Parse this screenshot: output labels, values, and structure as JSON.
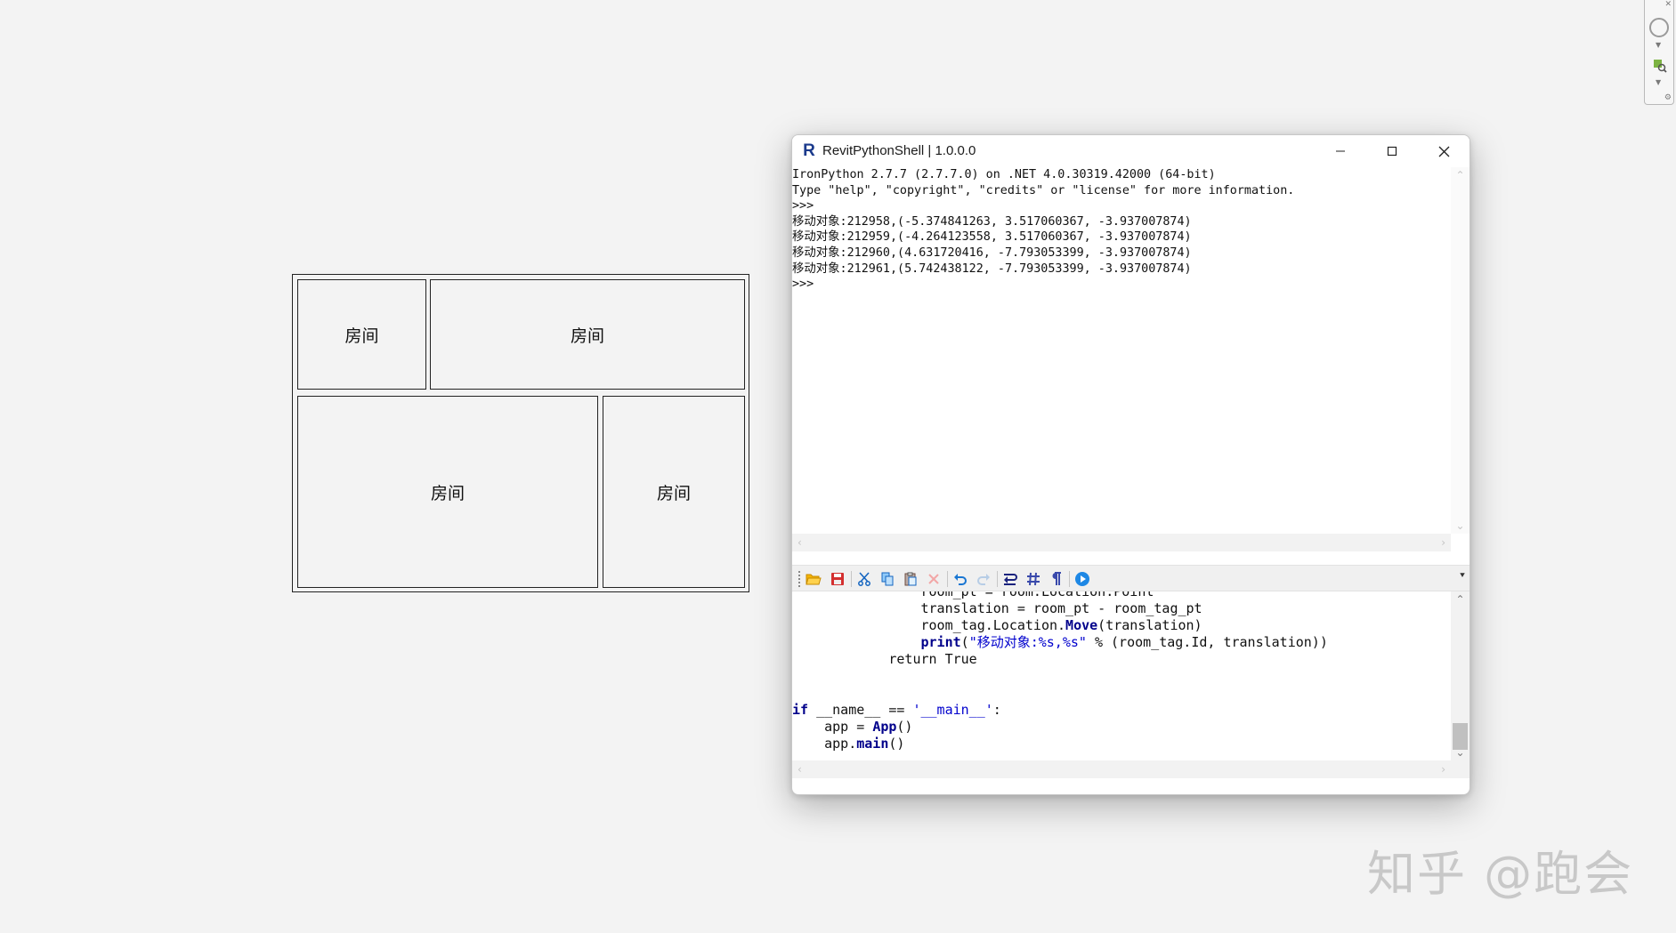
{
  "floor_plan": {
    "rooms": [
      {
        "label": "房间"
      },
      {
        "label": "房间"
      },
      {
        "label": "房间"
      },
      {
        "label": "房间"
      }
    ]
  },
  "navbar": {
    "icons": [
      "close-icon",
      "steering-wheel-icon",
      "dropdown-icon",
      "zoom-icon",
      "dropdown-icon",
      "customize-icon"
    ]
  },
  "shell": {
    "title": "RevitPythonShell | 1.0.0.0",
    "app_icon_letter": "R",
    "output_lines": [
      "IronPython 2.7.7 (2.7.7.0) on .NET 4.0.30319.42000 (64-bit)",
      "Type \"help\", \"copyright\", \"credits\" or \"license\" for more information.",
      ">>>",
      "移动对象:212958,(-5.374841263, 3.517060367, -3.937007874)",
      "移动对象:212959,(-4.264123558, 3.517060367, -3.937007874)",
      "移动对象:212960,(4.631720416, -7.793053399, -3.937007874)",
      "移动对象:212961,(5.742438122, -7.793053399, -3.937007874)",
      ">>>"
    ],
    "toolbar": [
      "open-icon",
      "save-icon",
      "cut-icon",
      "copy-icon",
      "paste-icon",
      "delete-icon",
      "undo-icon",
      "redo-icon",
      "word-wrap-icon",
      "line-numbers-icon",
      "show-whitespace-icon",
      "run-icon"
    ],
    "code": {
      "line0": "                room_pt = room.Location.Point",
      "line1": "                translation = room_pt - room_tag_pt",
      "line2": "                room_tag.Location.",
      "line2_fn": "Move",
      "line2_rest": "(translation)",
      "line3_kw": "print",
      "line3_str": "\"移动对象:%s,%s\"",
      "line3_rest": " % (room_tag.Id, translation))",
      "line4": "            return True",
      "line5_kw": "if",
      "line5_mid": " __name__ == ",
      "line5_str": "'__main__'",
      "line5_end": ":",
      "line6_a": "    app = ",
      "line6_fn": "App",
      "line6_b": "()",
      "line7_a": "    app.",
      "line7_fn": "main",
      "line7_b": "()"
    }
  },
  "watermark": "知乎 @跑会",
  "colors": {
    "background": "#f3f3f3",
    "keyword": "#00008b",
    "string": "#0000cd",
    "run_icon": "#1e88e5"
  }
}
